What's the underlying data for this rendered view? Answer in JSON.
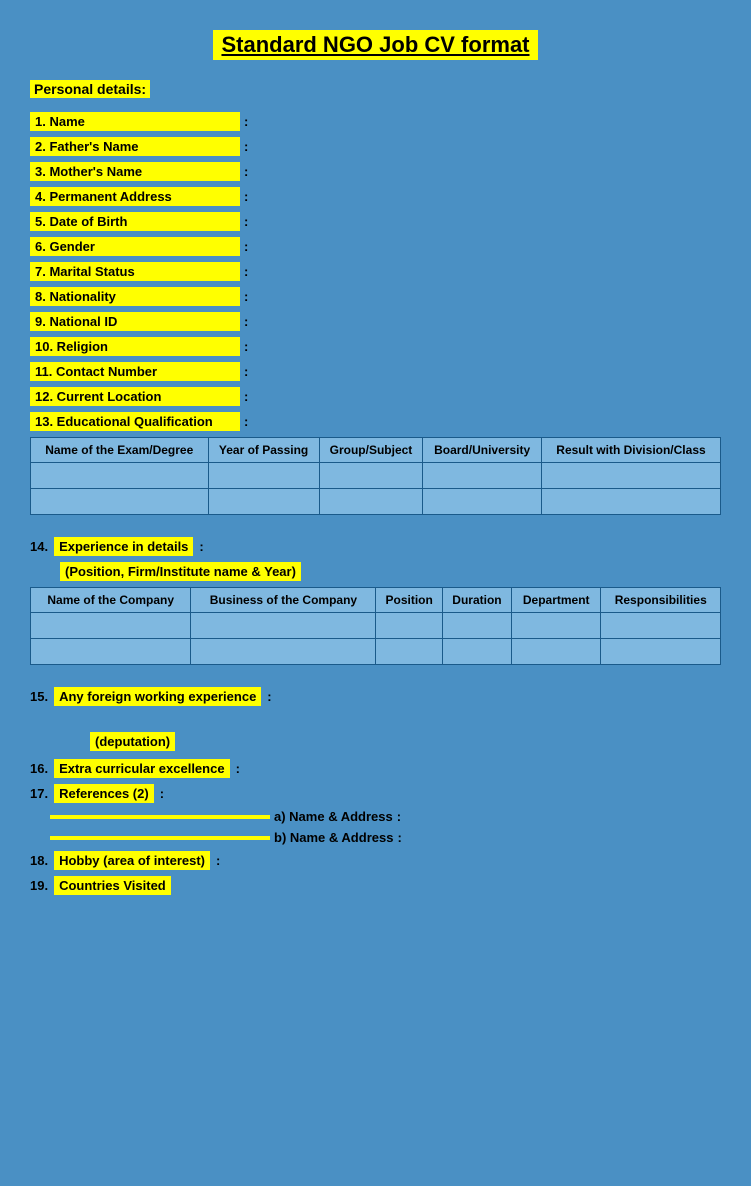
{
  "title": "Standard NGO Job CV format",
  "personal_details_label": "Personal details:",
  "fields": [
    {
      "num": "1.",
      "label": "Name"
    },
    {
      "num": "2.",
      "label": "Father's Name"
    },
    {
      "num": "3.",
      "label": "Mother's Name"
    },
    {
      "num": "4.",
      "label": "Permanent Address"
    },
    {
      "num": "5.",
      "label": "Date of Birth"
    },
    {
      "num": "6.",
      "label": "Gender"
    },
    {
      "num": "7.",
      "label": "Marital Status"
    },
    {
      "num": "8.",
      "label": "Nationality"
    },
    {
      "num": "9.",
      "label": "National ID"
    },
    {
      "num": "10.",
      "label": "Religion"
    },
    {
      "num": "11.",
      "label": "Contact Number"
    },
    {
      "num": "12.",
      "label": "Current Location"
    },
    {
      "num": "13.",
      "label": "Educational Qualification"
    }
  ],
  "edu_table": {
    "headers": [
      "Name of the Exam/Degree",
      "Year of Passing",
      "Group/Subject",
      "Board/University",
      "Result with Division/Class"
    ],
    "rows": [
      [
        "",
        "",
        "",
        "",
        ""
      ],
      [
        "",
        "",
        "",
        "",
        ""
      ]
    ]
  },
  "experience": {
    "num": "14.",
    "label": "Experience in details",
    "sublabel": "(Position, Firm/Institute name & Year)"
  },
  "exp_table": {
    "headers": [
      "Name of the Company",
      "Business of the Company",
      "Position",
      "Duration",
      "Department",
      "Responsibilities"
    ],
    "rows": [
      [
        "",
        "",
        "",
        "",
        "",
        ""
      ],
      [
        "",
        "",
        "",
        "",
        "",
        ""
      ]
    ]
  },
  "foreign_exp": {
    "num": "15.",
    "label": "Any foreign working experience"
  },
  "deputation": "(deputation)",
  "extra_curricular": {
    "num": "16.",
    "label": "Extra curricular excellence"
  },
  "references": {
    "num": "17.",
    "label": "References (2)"
  },
  "ref_a": {
    "prefix": "a)",
    "label": "Name & Address"
  },
  "ref_b": {
    "prefix": "b)",
    "label": "Name & Address"
  },
  "hobby": {
    "num": "18.",
    "label": "Hobby (area of interest)"
  },
  "countries": {
    "num": "19.",
    "label": "Countries Visited"
  },
  "colon": ":"
}
